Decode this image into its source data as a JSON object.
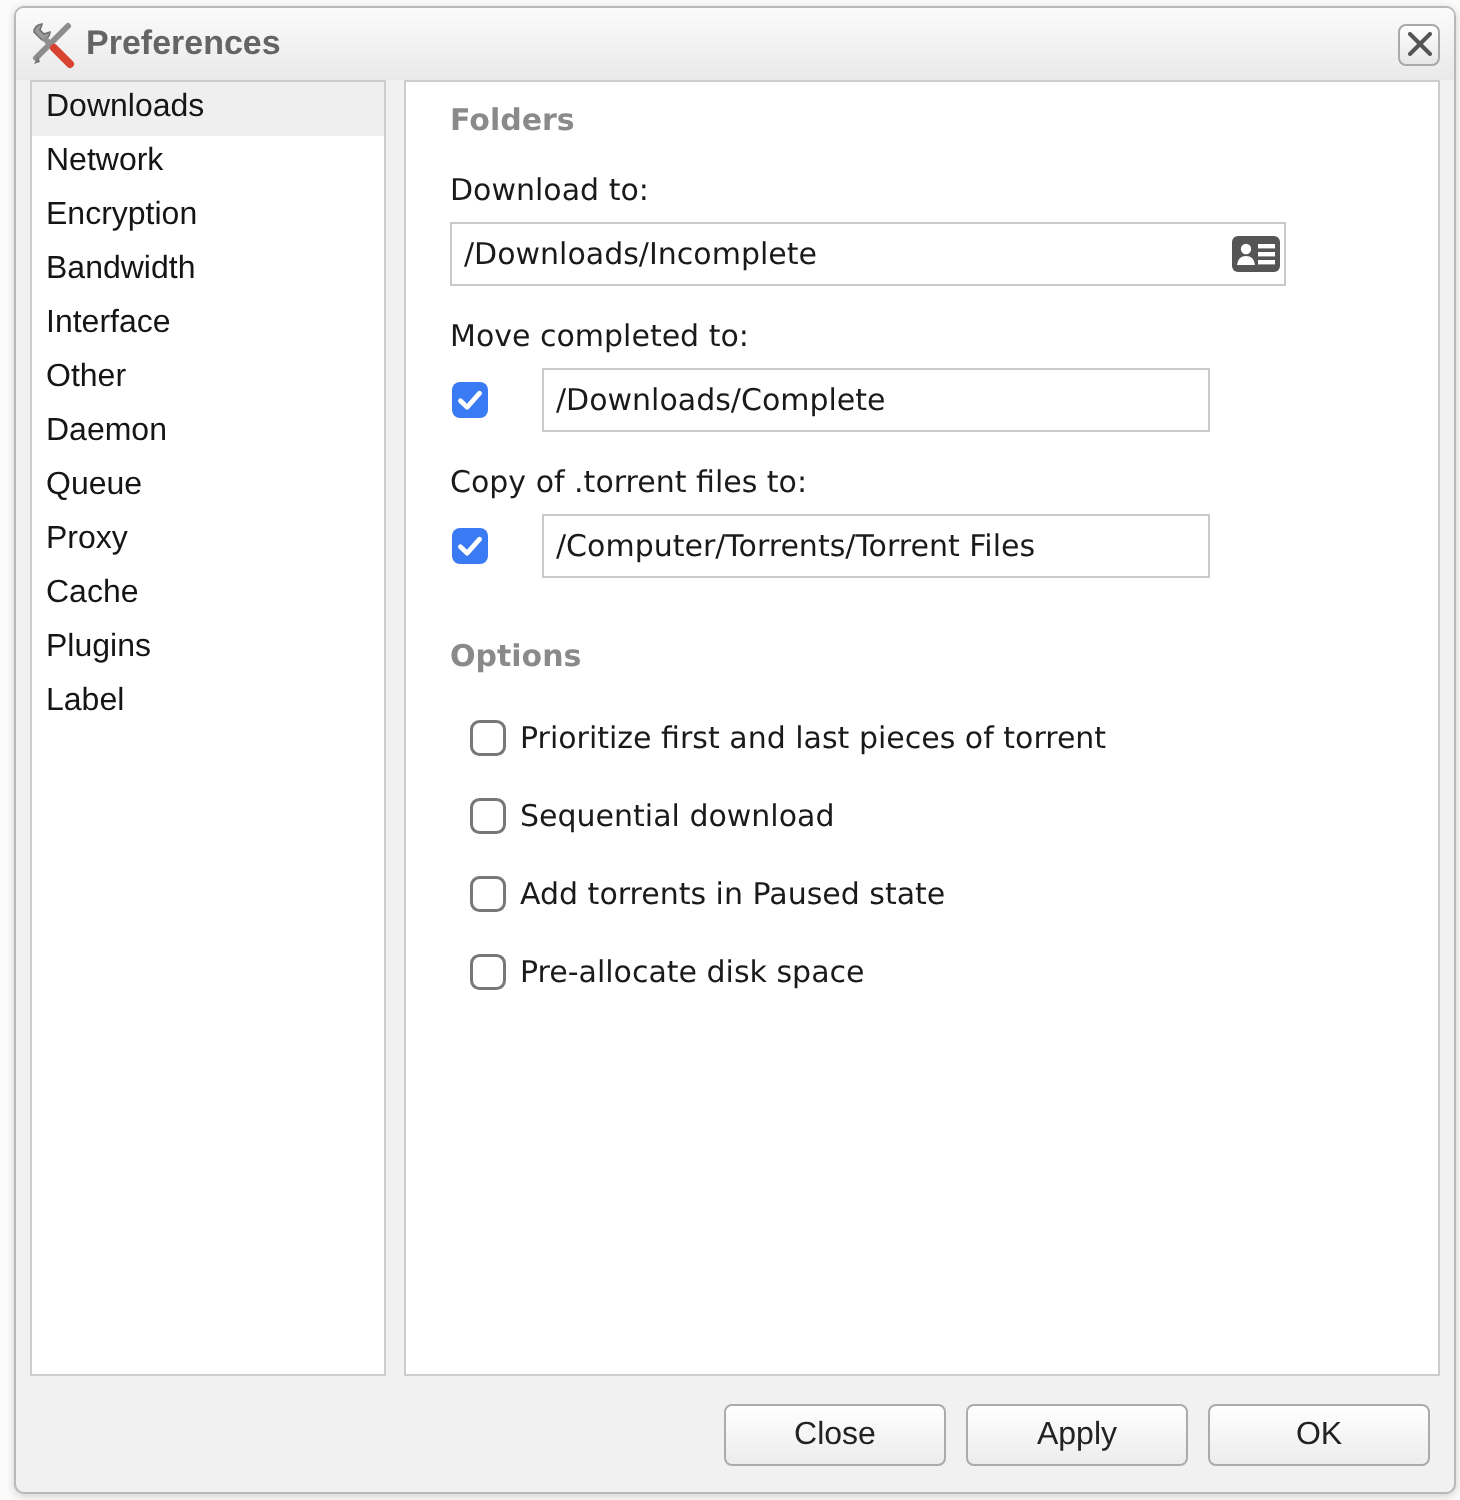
{
  "window": {
    "title": "Preferences"
  },
  "sidebar": {
    "items": [
      {
        "label": "Downloads",
        "selected": true
      },
      {
        "label": "Network",
        "selected": false
      },
      {
        "label": "Encryption",
        "selected": false
      },
      {
        "label": "Bandwidth",
        "selected": false
      },
      {
        "label": "Interface",
        "selected": false
      },
      {
        "label": "Other",
        "selected": false
      },
      {
        "label": "Daemon",
        "selected": false
      },
      {
        "label": "Queue",
        "selected": false
      },
      {
        "label": "Proxy",
        "selected": false
      },
      {
        "label": "Cache",
        "selected": false
      },
      {
        "label": "Plugins",
        "selected": false
      },
      {
        "label": "Label",
        "selected": false
      }
    ]
  },
  "folders": {
    "heading": "Folders",
    "fields": [
      {
        "kind": "browse",
        "label": "Download to:",
        "value": "/Downloads/Incomplete"
      },
      {
        "kind": "toggle",
        "label": "Move completed to:",
        "checked": true,
        "value": "/Downloads/Complete"
      },
      {
        "kind": "toggle",
        "label": "Copy of .torrent files to:",
        "checked": true,
        "value": "/Computer/Torrents/Torrent Files"
      }
    ]
  },
  "options": {
    "heading": "Options",
    "items": [
      {
        "label": "Prioritize first and last pieces of torrent",
        "checked": false
      },
      {
        "label": "Sequential download",
        "checked": false
      },
      {
        "label": "Add torrents in Paused state",
        "checked": false
      },
      {
        "label": "Pre-allocate disk space",
        "checked": false
      }
    ]
  },
  "buttons": [
    "Close",
    "Apply",
    "OK"
  ]
}
